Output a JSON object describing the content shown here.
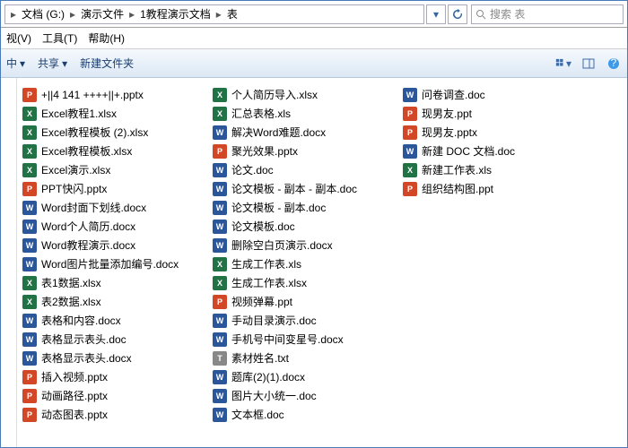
{
  "breadcrumbs": [
    "文档 (G:)",
    "演示文件",
    "1教程演示文档",
    "表"
  ],
  "search": {
    "placeholder": "搜索 表"
  },
  "menu": {
    "view": "视(V)",
    "tools": "工具(T)",
    "help": "帮助(H)"
  },
  "toolbar": {
    "open": "中",
    "share": "共享",
    "newfolder": "新建文件夹"
  },
  "files": [
    {
      "n": "+||4 141 ++++||+.pptx",
      "t": "pptx"
    },
    {
      "n": "Excel教程1.xlsx",
      "t": "xlsx"
    },
    {
      "n": "Excel教程模板 (2).xlsx",
      "t": "xlsx"
    },
    {
      "n": "Excel教程模板.xlsx",
      "t": "xlsx"
    },
    {
      "n": "Excel演示.xlsx",
      "t": "xlsx"
    },
    {
      "n": "PPT快闪.pptx",
      "t": "pptx"
    },
    {
      "n": "Word封面下划线.docx",
      "t": "docx"
    },
    {
      "n": "Word个人简历.docx",
      "t": "docx"
    },
    {
      "n": "Word教程演示.docx",
      "t": "docx"
    },
    {
      "n": "Word图片批量添加编号.docx",
      "t": "docx"
    },
    {
      "n": "表1数据.xlsx",
      "t": "xlsx"
    },
    {
      "n": "表2数据.xlsx",
      "t": "xlsx"
    },
    {
      "n": "表格和内容.docx",
      "t": "docx"
    },
    {
      "n": "表格显示表头.doc",
      "t": "docx"
    },
    {
      "n": "表格显示表头.docx",
      "t": "docx"
    },
    {
      "n": "插入视频.pptx",
      "t": "pptx"
    },
    {
      "n": "动画路径.pptx",
      "t": "pptx"
    },
    {
      "n": "动态图表.pptx",
      "t": "pptx"
    },
    {
      "n": "个人简历导入.xlsx",
      "t": "xlsx"
    },
    {
      "n": "汇总表格.xls",
      "t": "xlsx"
    },
    {
      "n": "解决Word难题.docx",
      "t": "docx"
    },
    {
      "n": "聚光效果.pptx",
      "t": "pptx"
    },
    {
      "n": "论文.doc",
      "t": "docx"
    },
    {
      "n": "论文模板 - 副本 - 副本.doc",
      "t": "docx"
    },
    {
      "n": "论文模板 - 副本.doc",
      "t": "docx"
    },
    {
      "n": "论文模板.doc",
      "t": "docx"
    },
    {
      "n": "删除空白页演示.docx",
      "t": "docx"
    },
    {
      "n": "生成工作表.xls",
      "t": "xlsx"
    },
    {
      "n": "生成工作表.xlsx",
      "t": "xlsx"
    },
    {
      "n": "视频弹幕.ppt",
      "t": "pptx"
    },
    {
      "n": "手动目录演示.doc",
      "t": "docx"
    },
    {
      "n": "手机号中间变星号.docx",
      "t": "docx"
    },
    {
      "n": "素材姓名.txt",
      "t": "txt"
    },
    {
      "n": "题库(2)(1).docx",
      "t": "docx"
    },
    {
      "n": "图片大小统一.doc",
      "t": "docx"
    },
    {
      "n": "文本框.doc",
      "t": "docx"
    },
    {
      "n": "问卷调查.doc",
      "t": "docx"
    },
    {
      "n": "现男友.ppt",
      "t": "pptx"
    },
    {
      "n": "现男友.pptx",
      "t": "pptx"
    },
    {
      "n": "新建 DOC 文档.doc",
      "t": "docx"
    },
    {
      "n": "新建工作表.xls",
      "t": "xlsx"
    },
    {
      "n": "组织结构图.ppt",
      "t": "pptx"
    }
  ],
  "iconglyph": {
    "pptx": "P",
    "xlsx": "X",
    "docx": "W",
    "txt": "T"
  }
}
